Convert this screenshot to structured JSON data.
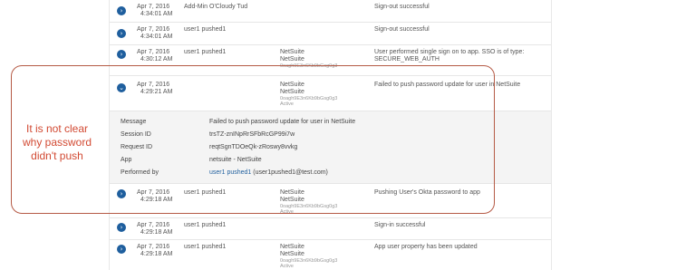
{
  "annotation": {
    "text": "It is not clear why password didn't push",
    "color": "#d24a33"
  },
  "rows": [
    {
      "date": "Apr 7, 2016",
      "time": "4:34:01 AM",
      "actor": "Add-Min O'Cloudy Tud",
      "target": "",
      "target_sub": "",
      "target_id": "",
      "target_status": "",
      "event": "Sign-out successful"
    },
    {
      "date": "Apr 7, 2016",
      "time": "4:34:01 AM",
      "actor": "user1 pushed1",
      "target": "",
      "target_sub": "",
      "target_id": "",
      "target_status": "",
      "event": "Sign-out successful"
    },
    {
      "date": "Apr 7, 2016",
      "time": "4:30:12 AM",
      "actor": "user1 pushed1",
      "target": "NetSuite",
      "target_sub": "NetSuite",
      "target_id": "0oagh9E3n6Kb9bGsg0g3",
      "target_status": "Active",
      "event": "User performed single sign on to app. SSO is of type: SECURE_WEB_AUTH"
    },
    {
      "date": "Apr 7, 2016",
      "time": "4:29:21 AM",
      "actor": "",
      "target": "NetSuite",
      "target_sub": "NetSuite",
      "target_id": "0oagh9E3n6Kb9bGsg0g3",
      "target_status": "Active",
      "event": "Failed to push password update for user in NetSuite"
    },
    {
      "date": "Apr 7, 2016",
      "time": "4:29:18 AM",
      "actor": "user1 pushed1",
      "target": "NetSuite",
      "target_sub": "NetSuite",
      "target_id": "0oagh9E3n6Kb9bGsg0g3",
      "target_status": "Active",
      "event": "Pushing User's Okta password to app"
    },
    {
      "date": "Apr 7, 2016",
      "time": "4:29:18 AM",
      "actor": "user1 pushed1",
      "target": "",
      "target_sub": "",
      "target_id": "",
      "target_status": "",
      "event": "Sign-in successful"
    },
    {
      "date": "Apr 7, 2016",
      "time": "4:29:18 AM",
      "actor": "user1 pushed1",
      "target": "NetSuite",
      "target_sub": "NetSuite",
      "target_id": "0oagh9E3n6Kb9bGsg0g3",
      "target_status": "Active",
      "event": "App user property has been updated"
    }
  ],
  "details": {
    "message_label": "Message",
    "message": "Failed to push password update for user in NetSuite",
    "session_label": "Session ID",
    "session": "trsTZ-znINpRrSFbRcGP99i7w",
    "request_label": "Request ID",
    "request": "reqtSgnTDOeQk-zRoswy8vvkg",
    "app_label": "App",
    "app": "netsuite - NetSuite",
    "performer_label": "Performed by",
    "performer_link": "user1 pushed1",
    "performer_email": "(user1pushed1@test.com)"
  }
}
